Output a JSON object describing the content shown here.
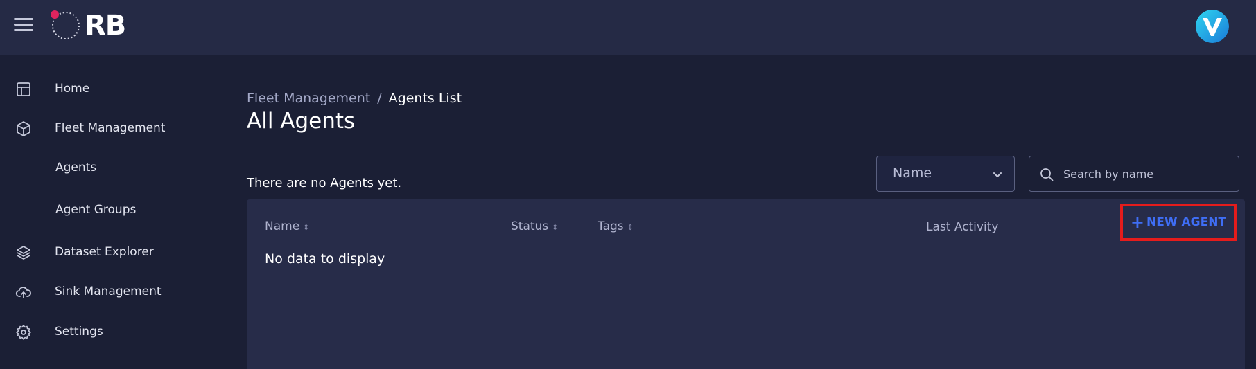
{
  "app": {
    "logo_text": "RB",
    "brand_accent": "#e0245e"
  },
  "icons": {
    "menu": "hamburger-menu-icon",
    "avatar": "user-avatar",
    "chevron": "chevron-down-icon",
    "search": "search-icon"
  },
  "sidebar": {
    "items": [
      {
        "label": "Home",
        "icon": "layout-icon"
      },
      {
        "label": "Fleet Management",
        "icon": "cube-icon"
      },
      {
        "label": "Agents",
        "icon": ""
      },
      {
        "label": "Agent Groups",
        "icon": ""
      },
      {
        "label": "Dataset Explorer",
        "icon": "layers-icon"
      },
      {
        "label": "Sink Management",
        "icon": "cloud-upload-icon"
      },
      {
        "label": "Settings",
        "icon": "gear-icon"
      }
    ]
  },
  "breadcrumb": {
    "parent": "Fleet Management",
    "separator": "/",
    "current": "Agents List"
  },
  "page": {
    "title": "All Agents",
    "empty_message": "There are no Agents yet."
  },
  "filter": {
    "selected": "Name"
  },
  "search": {
    "placeholder": "Search by name",
    "value": ""
  },
  "table": {
    "columns": [
      "Name",
      "Status",
      "Tags",
      "Last Activity"
    ],
    "no_data": "No data to display",
    "new_button": "NEW AGENT",
    "new_button_plus": "+"
  },
  "colors": {
    "background": "#1b1f35",
    "topbar": "#252a45",
    "table": "#272c49",
    "accent_blue": "#3f6ef5",
    "highlight_red": "#e51c1c"
  }
}
